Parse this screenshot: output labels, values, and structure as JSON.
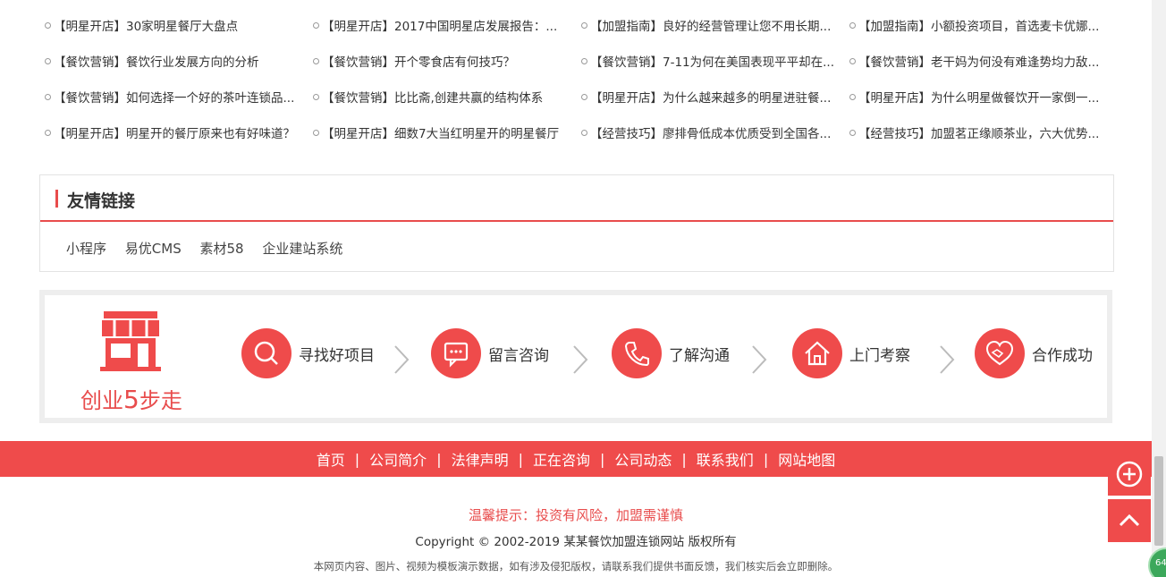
{
  "news": [
    [
      "【明星开店】30家明星餐厅大盘点",
      "【明星开店】2017中国明星店发展报告：...",
      "【加盟指南】良好的经营管理让您不用长期...",
      "【加盟指南】小额投资项目，首选麦卡优娜..."
    ],
    [
      "【餐饮营销】餐饮行业发展方向的分析",
      "【餐饮营销】开个零食店有何技巧？",
      "【餐饮营销】7-11为何在美国表现平平却在...",
      "【餐饮营销】老干妈为何没有难逢势均力敌..."
    ],
    [
      "【餐饮营销】如何选择一个好的茶叶连锁品...",
      "【餐饮营销】比比斋,创建共赢的结构体系",
      "【明星开店】为什么越来越多的明星进驻餐...",
      "【明星开店】为什么明星做餐饮开一家倒一..."
    ],
    [
      "【明星开店】明星开的餐厅原来也有好味道？",
      "【明星开店】细数7大当红明星开的明星餐厅",
      "【经营技巧】廖排骨低成本优质受到全国各...",
      "【经营技巧】加盟茗正缘顺茶业，六大优势..."
    ]
  ],
  "friend_links": {
    "title": "友情链接",
    "items": [
      "小程序",
      "易优CMS",
      "素材58",
      "企业建站系统"
    ]
  },
  "steps": {
    "brand_prefix": "创业",
    "brand_num": "5",
    "brand_suffix": "步走",
    "items": [
      {
        "label": "寻找好项目",
        "icon": "search-icon"
      },
      {
        "label": "留言咨询",
        "icon": "message-icon"
      },
      {
        "label": "了解沟通",
        "icon": "phone-icon"
      },
      {
        "label": "上门考察",
        "icon": "home-icon"
      },
      {
        "label": "合作成功",
        "icon": "handshake-icon"
      }
    ]
  },
  "footer_nav": [
    "首页",
    "公司简介",
    "法律声明",
    "正在咨询",
    "公司动态",
    "联系我们",
    "网站地图"
  ],
  "tip": "温馨提示：投资有风险，加盟需谨慎",
  "copyright": "Copyright © 2002-2019 某某餐饮加盟连锁网站 版权所有",
  "disclaimer": "本网页内容、图片、视频为模板演示数据，如有涉及侵犯版权，请联系我们提供书面反馈，我们核实后会立即删除。",
  "badge": "64",
  "colors": {
    "accent": "#ef4b4b",
    "border": "#eeeeee"
  }
}
